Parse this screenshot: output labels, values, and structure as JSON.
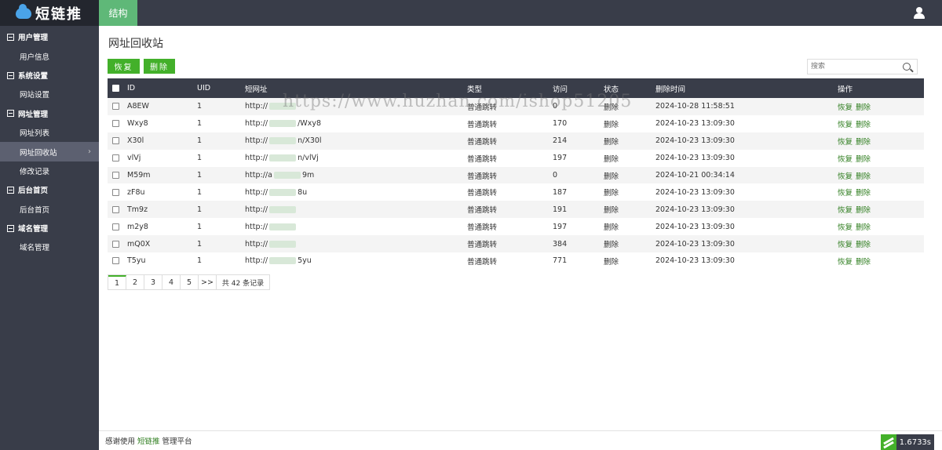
{
  "header": {
    "logo_text": "短链推",
    "tab_label": "结构"
  },
  "sidebar": {
    "groups": [
      {
        "label": "用户管理",
        "items": [
          {
            "label": "用户信息"
          }
        ]
      },
      {
        "label": "系统设置",
        "items": [
          {
            "label": "网站设置"
          }
        ]
      },
      {
        "label": "网址管理",
        "items": [
          {
            "label": "网址列表"
          },
          {
            "label": "网址回收站",
            "active": true
          },
          {
            "label": "修改记录"
          }
        ]
      },
      {
        "label": "后台首页",
        "items": [
          {
            "label": "后台首页"
          }
        ]
      },
      {
        "label": "域名管理",
        "items": [
          {
            "label": "域名管理"
          }
        ]
      }
    ],
    "arrow": "›"
  },
  "main": {
    "title": "网址回收站",
    "restore_label": "恢复",
    "delete_label": "删除",
    "search_placeholder": "搜索"
  },
  "table": {
    "columns": [
      "ID",
      "UID",
      "短网址",
      "类型",
      "访问",
      "状态",
      "删除时间",
      "操作"
    ],
    "rows": [
      {
        "id": "A8EW",
        "uid": "1",
        "url_prefix": "http://",
        "url_suffix": "",
        "type": "普通跳转",
        "visits": "0",
        "status": "删除",
        "time": "2024-10-28 11:58:51"
      },
      {
        "id": "Wxy8",
        "uid": "1",
        "url_prefix": "http://",
        "url_suffix": "/Wxy8",
        "type": "普通跳转",
        "visits": "170",
        "status": "删除",
        "time": "2024-10-23 13:09:30"
      },
      {
        "id": "X30l",
        "uid": "1",
        "url_prefix": "http://",
        "url_suffix": "n/X30l",
        "type": "普通跳转",
        "visits": "214",
        "status": "删除",
        "time": "2024-10-23 13:09:30"
      },
      {
        "id": "vlVj",
        "uid": "1",
        "url_prefix": "http://",
        "url_suffix": "n/vlVj",
        "type": "普通跳转",
        "visits": "197",
        "status": "删除",
        "time": "2024-10-23 13:09:30"
      },
      {
        "id": "M59m",
        "uid": "1",
        "url_prefix": "http://a",
        "url_suffix": "9m",
        "type": "普通跳转",
        "visits": "0",
        "status": "删除",
        "time": "2024-10-21 00:34:14"
      },
      {
        "id": "zF8u",
        "uid": "1",
        "url_prefix": "http://",
        "url_suffix": "8u",
        "type": "普通跳转",
        "visits": "187",
        "status": "删除",
        "time": "2024-10-23 13:09:30"
      },
      {
        "id": "Tm9z",
        "uid": "1",
        "url_prefix": "http://",
        "url_suffix": "",
        "type": "普通跳转",
        "visits": "191",
        "status": "删除",
        "time": "2024-10-23 13:09:30"
      },
      {
        "id": "m2y8",
        "uid": "1",
        "url_prefix": "http://",
        "url_suffix": "",
        "type": "普通跳转",
        "visits": "197",
        "status": "删除",
        "time": "2024-10-23 13:09:30"
      },
      {
        "id": "mQ0X",
        "uid": "1",
        "url_prefix": "http://",
        "url_suffix": "",
        "type": "普通跳转",
        "visits": "384",
        "status": "删除",
        "time": "2024-10-23 13:09:30"
      },
      {
        "id": "T5yu",
        "uid": "1",
        "url_prefix": "http://",
        "url_suffix": "5yu",
        "type": "普通跳转",
        "visits": "771",
        "status": "删除",
        "time": "2024-10-23 13:09:30"
      }
    ],
    "op_restore": "恢复",
    "op_delete": "删除"
  },
  "pagination": {
    "pages": [
      "1",
      "2",
      "3",
      "4",
      "5"
    ],
    "next": ">>",
    "total": "共 42 条记录",
    "current": "1"
  },
  "footer": {
    "prefix": "感谢使用",
    "brand": "短链推",
    "suffix": "管理平台",
    "timer": "1.6733s"
  },
  "watermark": "https://www.huzhan.com/ishop51205",
  "colors": {
    "accent": "#43b02a",
    "dark": "#393d49",
    "link": "#2e7d1e"
  }
}
